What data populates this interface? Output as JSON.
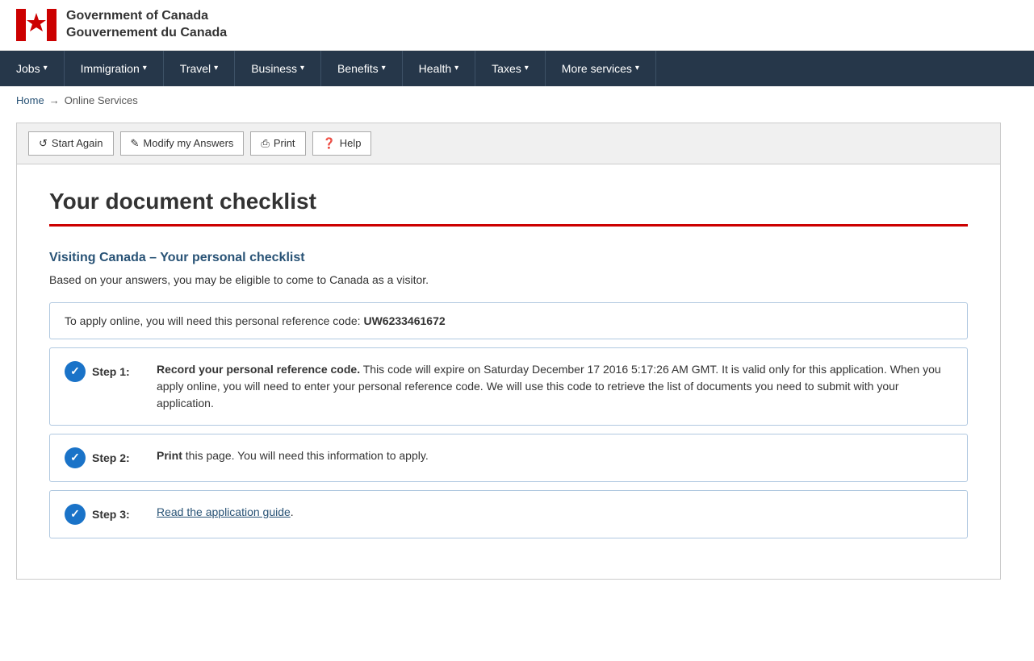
{
  "header": {
    "logo_line1": "Government",
    "logo_line2": "of Canada",
    "logo_line3": "Gouvernement",
    "logo_line4": "du Canada"
  },
  "nav": {
    "items": [
      {
        "label": "Jobs",
        "id": "jobs"
      },
      {
        "label": "Immigration",
        "id": "immigration"
      },
      {
        "label": "Travel",
        "id": "travel"
      },
      {
        "label": "Business",
        "id": "business"
      },
      {
        "label": "Benefits",
        "id": "benefits"
      },
      {
        "label": "Health",
        "id": "health"
      },
      {
        "label": "Taxes",
        "id": "taxes"
      },
      {
        "label": "More services",
        "id": "more-services"
      }
    ]
  },
  "breadcrumb": {
    "home": "Home",
    "arrow": "→",
    "current": "Online Services"
  },
  "toolbar": {
    "start_again": "Start Again",
    "modify": "Modify my Answers",
    "print": "Print",
    "help": "Help"
  },
  "page": {
    "title": "Your document checklist",
    "section_title": "Visiting Canada – Your personal checklist",
    "description": "Based on your answers, you may be eligible to come to Canada as a visitor.",
    "ref_box": {
      "text": "To apply online, you will need this personal reference code:",
      "code": "UW6233461672"
    },
    "steps": [
      {
        "id": "step1",
        "label": "Step 1:",
        "content_bold": "Record your personal reference code.",
        "content": " This code will expire on Saturday December 17 2016 5:17:26 AM GMT. It is valid only for this application. When you apply online, you will need to enter your personal reference code. We will use this code to retrieve the list of documents you need to submit with your application."
      },
      {
        "id": "step2",
        "label": "Step 2:",
        "content_bold": "Print",
        "content": " this page. You will need this information to apply."
      },
      {
        "id": "step3",
        "label": "Step 3:",
        "link_text": "Read the application guide",
        "content": "."
      }
    ]
  }
}
